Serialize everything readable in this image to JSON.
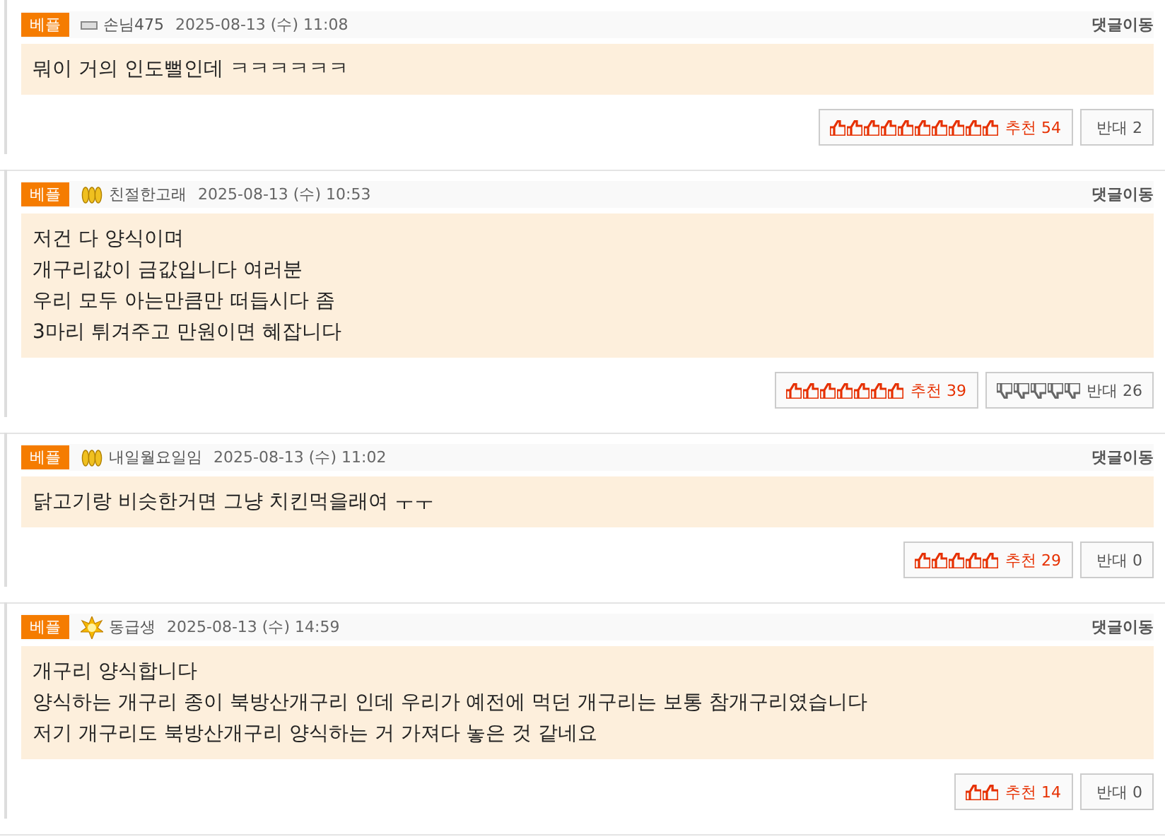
{
  "comments": [
    {
      "badge": "베플",
      "level_icon": {
        "kind": "bar"
      },
      "author": "손님475",
      "date": "2025-08-13 (수) 11:08",
      "jump": "댓글이동",
      "lines": [
        "뭐이 거의 인도뻘인데 ㅋㅋㅋㅋㅋㅋ"
      ],
      "up": {
        "label": "추천",
        "count": "54",
        "icons": [
          {
            "kind": "thumb_up"
          },
          {
            "kind": "thumb_up"
          },
          {
            "kind": "thumb_up"
          },
          {
            "kind": "thumb_up"
          },
          {
            "kind": "thumb_up"
          },
          {
            "kind": "thumb_up"
          },
          {
            "kind": "thumb_up"
          },
          {
            "kind": "thumb_up"
          },
          {
            "kind": "thumb_up"
          },
          {
            "kind": "thumb_up"
          }
        ]
      },
      "down": {
        "label": "반대",
        "count": "2"
      }
    },
    {
      "badge": "베플",
      "level_icon": {
        "kind": "wheat"
      },
      "author": "친절한고래",
      "date": "2025-08-13 (수) 10:53",
      "jump": "댓글이동",
      "lines": [
        "저건 다 양식이며",
        "개구리값이 금값입니다 여러분",
        "우리 모두 아는만큼만 떠듭시다 좀",
        "3마리 튀겨주고 만원이면 혜잡니다"
      ],
      "up": {
        "label": "추천",
        "count": "39",
        "icons": [
          {
            "kind": "thumb_up"
          },
          {
            "kind": "thumb_up"
          },
          {
            "kind": "thumb_up"
          },
          {
            "kind": "thumb_up"
          },
          {
            "kind": "thumb_up"
          },
          {
            "kind": "thumb_up"
          },
          {
            "kind": "thumb_up"
          }
        ]
      },
      "down": {
        "label": "반대",
        "count": "26",
        "icons": [
          {
            "kind": "thumb_down"
          },
          {
            "kind": "thumb_down"
          },
          {
            "kind": "thumb_down"
          },
          {
            "kind": "thumb_down"
          },
          {
            "kind": "thumb_down"
          }
        ]
      }
    },
    {
      "badge": "베플",
      "level_icon": {
        "kind": "wheat"
      },
      "author": "내일월요일임",
      "date": "2025-08-13 (수) 11:02",
      "jump": "댓글이동",
      "lines": [
        "닭고기랑 비슷한거면 그냥 치킨먹을래여 ㅜㅜ"
      ],
      "up": {
        "label": "추천",
        "count": "29",
        "icons": [
          {
            "kind": "thumb_up"
          },
          {
            "kind": "thumb_up"
          },
          {
            "kind": "thumb_up"
          },
          {
            "kind": "thumb_up"
          },
          {
            "kind": "thumb_up"
          }
        ]
      },
      "down": {
        "label": "반대",
        "count": "0"
      }
    },
    {
      "badge": "베플",
      "level_icon": {
        "kind": "sun"
      },
      "author": "동급생",
      "date": "2025-08-13 (수) 14:59",
      "jump": "댓글이동",
      "lines": [
        "개구리 양식합니다",
        "양식하는 개구리 종이 북방산개구리 인데 우리가 예전에 먹던 개구리는 보통 참개구리였습니다",
        "저기 개구리도 북방산개구리 양식하는 거 가져다 놓은 것 같네요"
      ],
      "up": {
        "label": "추천",
        "count": "14",
        "icons": [
          {
            "kind": "thumb_up"
          },
          {
            "kind": "thumb_up"
          }
        ]
      },
      "down": {
        "label": "반대",
        "count": "0"
      }
    }
  ]
}
